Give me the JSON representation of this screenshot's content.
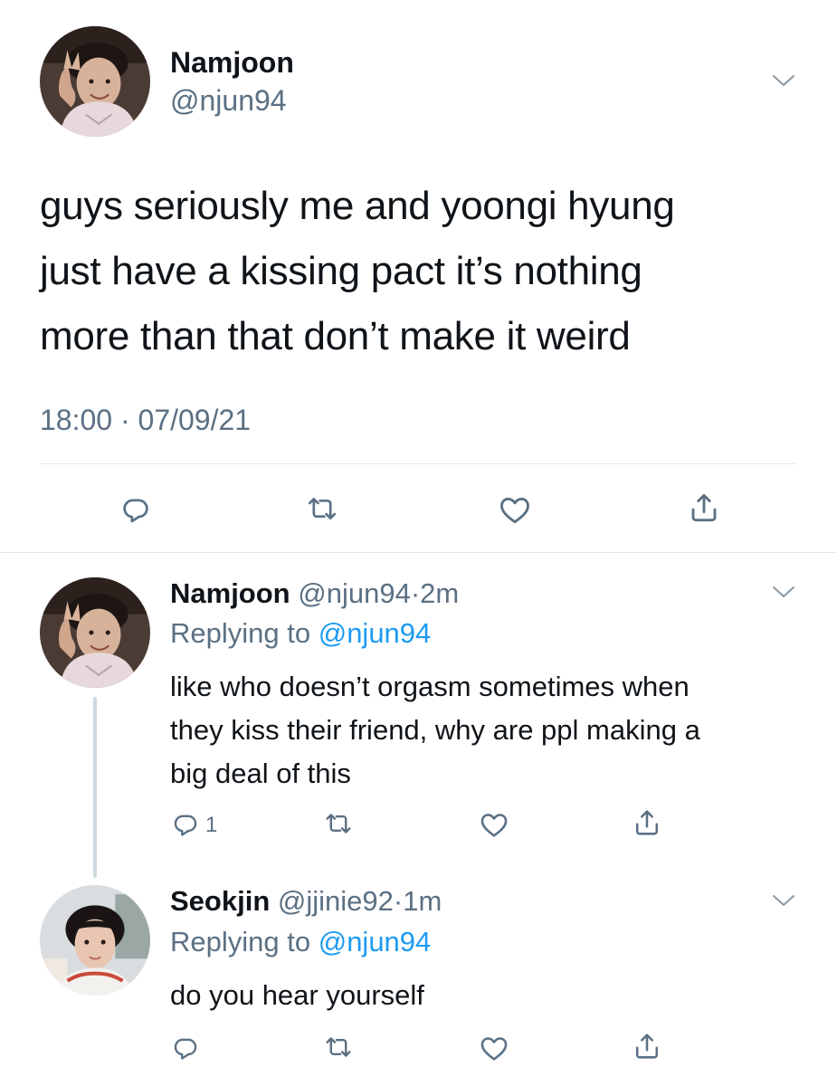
{
  "main_tweet": {
    "display_name": "Namjoon",
    "handle": "@njun94",
    "text_lines": [
      "guys seriously me and yoongi hyung",
      "just have a kissing pact it’s nothing",
      "more than that don’t make it weird"
    ],
    "timestamp": "18:00 · 07/09/21"
  },
  "replies": [
    {
      "display_name": "Namjoon",
      "handle": "@njun94",
      "separator": "·",
      "time": "2m",
      "replying_prefix": "Replying to ",
      "replying_handle": "@njun94",
      "text_lines": [
        "like who doesn’t orgasm sometimes when",
        "they kiss their friend, why are ppl making a",
        "big deal of this"
      ],
      "reply_count": "1"
    },
    {
      "display_name": "Seokjin",
      "handle": "@jjinie92",
      "separator": "·",
      "time": "1m",
      "replying_prefix": "Replying to ",
      "replying_handle": "@njun94",
      "text_lines": [
        "do you hear yourself"
      ],
      "reply_count": ""
    }
  ],
  "icons": {
    "reply": "reply-icon",
    "retweet": "retweet-icon",
    "like": "heart-icon",
    "share": "share-icon",
    "more": "chevron-down-icon"
  },
  "colors": {
    "text": "#0f1419",
    "secondary": "#5b7083",
    "link": "#1d9bf0",
    "divider": "#e1e8ed"
  }
}
